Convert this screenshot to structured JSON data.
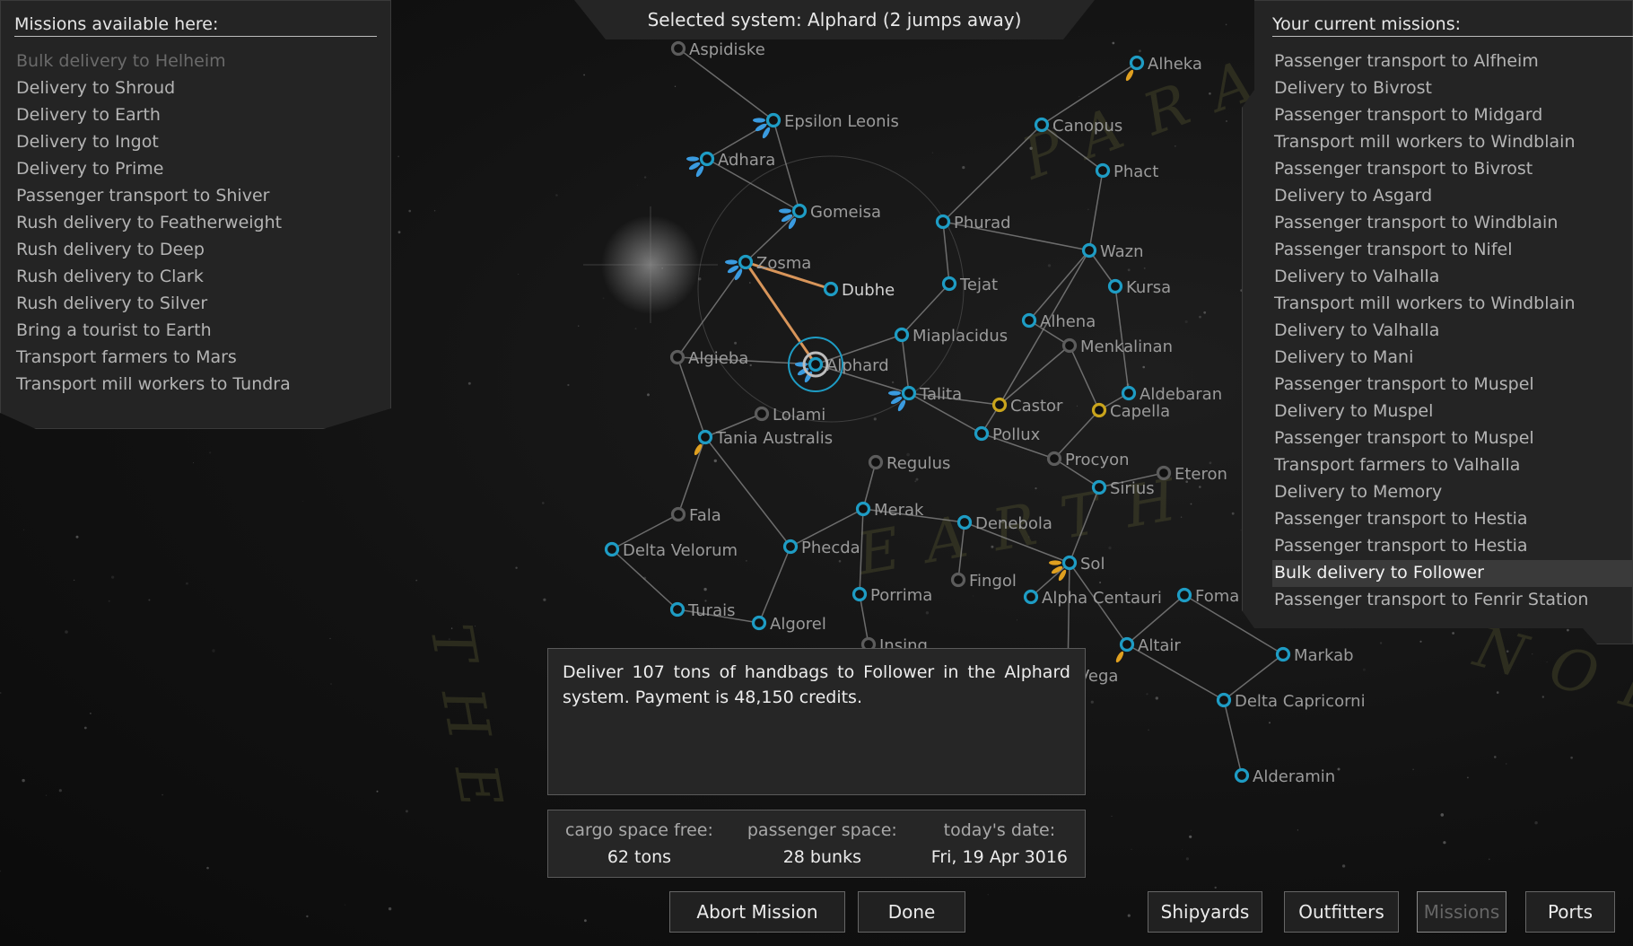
{
  "header": {
    "selected_system_text": "Selected system: Alphard (2 jumps away)"
  },
  "available_missions": {
    "title": "Missions available here:",
    "items": [
      {
        "label": "Bulk delivery to Helheim",
        "state": "unavailable"
      },
      {
        "label": "Delivery to Shroud",
        "state": "normal"
      },
      {
        "label": "Delivery to Earth",
        "state": "normal"
      },
      {
        "label": "Delivery to Ingot",
        "state": "normal"
      },
      {
        "label": "Delivery to Prime",
        "state": "normal"
      },
      {
        "label": "Passenger transport to Shiver",
        "state": "normal"
      },
      {
        "label": "Rush delivery to Featherweight",
        "state": "normal"
      },
      {
        "label": "Rush delivery to Deep",
        "state": "normal"
      },
      {
        "label": "Rush delivery to Clark",
        "state": "normal"
      },
      {
        "label": "Rush delivery to Silver",
        "state": "normal"
      },
      {
        "label": "Bring a tourist to Earth",
        "state": "normal"
      },
      {
        "label": "Transport farmers to Mars",
        "state": "normal"
      },
      {
        "label": "Transport mill workers to Tundra",
        "state": "normal"
      }
    ]
  },
  "current_missions": {
    "title": "Your current missions:",
    "items": [
      {
        "label": "Passenger transport to Alfheim",
        "state": "normal"
      },
      {
        "label": "Delivery to Bivrost",
        "state": "normal"
      },
      {
        "label": "Passenger transport to Midgard",
        "state": "normal"
      },
      {
        "label": "Transport mill workers to Windblain",
        "state": "normal"
      },
      {
        "label": "Passenger transport to Bivrost",
        "state": "normal"
      },
      {
        "label": "Delivery to Asgard",
        "state": "normal"
      },
      {
        "label": "Passenger transport to Windblain",
        "state": "normal"
      },
      {
        "label": "Passenger transport to Nifel",
        "state": "normal"
      },
      {
        "label": "Delivery to Valhalla",
        "state": "normal"
      },
      {
        "label": "Transport mill workers to Windblain",
        "state": "normal"
      },
      {
        "label": "Delivery to Valhalla",
        "state": "normal"
      },
      {
        "label": "Delivery to Mani",
        "state": "normal"
      },
      {
        "label": "Passenger transport to Muspel",
        "state": "normal"
      },
      {
        "label": "Delivery to Muspel",
        "state": "normal"
      },
      {
        "label": "Passenger transport to Muspel",
        "state": "normal"
      },
      {
        "label": "Transport farmers to Valhalla",
        "state": "normal"
      },
      {
        "label": "Delivery to Memory",
        "state": "normal"
      },
      {
        "label": "Passenger transport to Hestia",
        "state": "normal"
      },
      {
        "label": "Passenger transport to Hestia",
        "state": "normal"
      },
      {
        "label": "Bulk delivery to Follower",
        "state": "selected"
      },
      {
        "label": "Passenger transport to Fenrir Station",
        "state": "normal"
      }
    ]
  },
  "description": {
    "text": "Deliver 107 tons of handbags to Follower in the Alphard system. Payment is 48,150 credits."
  },
  "status": {
    "cargo_label": "cargo space free:",
    "cargo_value": "62 tons",
    "passenger_label": "passenger space:",
    "passenger_value": "28 bunks",
    "date_label": "today's date:",
    "date_value": "Fri, 19 Apr 3016"
  },
  "buttons": {
    "abort": "Abort Mission",
    "done": "Done",
    "shipyards": "Shipyards",
    "outfitters": "Outfitters",
    "missions": "Missions",
    "ports": "Ports"
  },
  "colors": {
    "visited_system": "#1e9cc4",
    "unvisited_system": "#5c5c5c",
    "other_government": "#c9a41c",
    "route": "#d8955a",
    "mission_marker_blue": "#3a9be0",
    "mission_marker_orange": "#e0a020",
    "link": "#8a8a8a"
  },
  "map": {
    "selected_system": "Alphard",
    "route": [
      "Alphard",
      "Zosma",
      "Dubhe"
    ],
    "watermarks": [
      "PARADISE",
      "EARTH",
      "THE",
      "NORTH"
    ],
    "systems": [
      {
        "name": "Aspidiske",
        "type": "unvisited"
      },
      {
        "name": "Epsilon Leonis",
        "type": "visited",
        "markers": "blue"
      },
      {
        "name": "Adhara",
        "type": "visited",
        "markers": "blue"
      },
      {
        "name": "Gomeisa",
        "type": "visited",
        "markers": "blue"
      },
      {
        "name": "Zosma",
        "type": "visited",
        "markers": "blue"
      },
      {
        "name": "Dubhe",
        "type": "visited",
        "current": true
      },
      {
        "name": "Algieba",
        "type": "unvisited"
      },
      {
        "name": "Alphard",
        "type": "visited",
        "selected": true,
        "markers": "blue"
      },
      {
        "name": "Lolami",
        "type": "unvisited"
      },
      {
        "name": "Tania Australis",
        "type": "visited",
        "markers": "orange"
      },
      {
        "name": "Miaplacidus",
        "type": "visited"
      },
      {
        "name": "Talita",
        "type": "visited",
        "markers": "blue"
      },
      {
        "name": "Canopus",
        "type": "visited"
      },
      {
        "name": "Phact",
        "type": "visited"
      },
      {
        "name": "Alheka",
        "type": "visited",
        "markers": "orange"
      },
      {
        "name": "Phurad",
        "type": "visited"
      },
      {
        "name": "Wazn",
        "type": "visited"
      },
      {
        "name": "Tejat",
        "type": "visited"
      },
      {
        "name": "Kursa",
        "type": "visited"
      },
      {
        "name": "Alhena",
        "type": "visited"
      },
      {
        "name": "Menkalinan",
        "type": "unvisited"
      },
      {
        "name": "Castor",
        "type": "other"
      },
      {
        "name": "Capella",
        "type": "other"
      },
      {
        "name": "Aldebaran",
        "type": "visited"
      },
      {
        "name": "Pollux",
        "type": "visited"
      },
      {
        "name": "Procyon",
        "type": "unvisited"
      },
      {
        "name": "Regulus",
        "type": "unvisited"
      },
      {
        "name": "Eteron",
        "type": "unvisited"
      },
      {
        "name": "Sirius",
        "type": "visited"
      },
      {
        "name": "Fala",
        "type": "unvisited"
      },
      {
        "name": "Merak",
        "type": "visited"
      },
      {
        "name": "Denebola",
        "type": "visited"
      },
      {
        "name": "Delta Velorum",
        "type": "visited"
      },
      {
        "name": "Phecda",
        "type": "visited"
      },
      {
        "name": "Sol",
        "type": "visited",
        "markers": "orange"
      },
      {
        "name": "Fingol",
        "type": "unvisited"
      },
      {
        "name": "Alpha Centauri",
        "type": "visited"
      },
      {
        "name": "Turais",
        "type": "visited"
      },
      {
        "name": "Porrima",
        "type": "visited"
      },
      {
        "name": "Algorel",
        "type": "visited"
      },
      {
        "name": "Fomalhaut",
        "type": "visited"
      },
      {
        "name": "Insing",
        "type": "unvisited"
      },
      {
        "name": "Altair",
        "type": "visited",
        "markers": "orange"
      },
      {
        "name": "Vega",
        "type": "visited"
      },
      {
        "name": "Markab",
        "type": "visited"
      },
      {
        "name": "Delta Capricorni",
        "type": "visited"
      },
      {
        "name": "Alderamin",
        "type": "visited"
      }
    ]
  }
}
